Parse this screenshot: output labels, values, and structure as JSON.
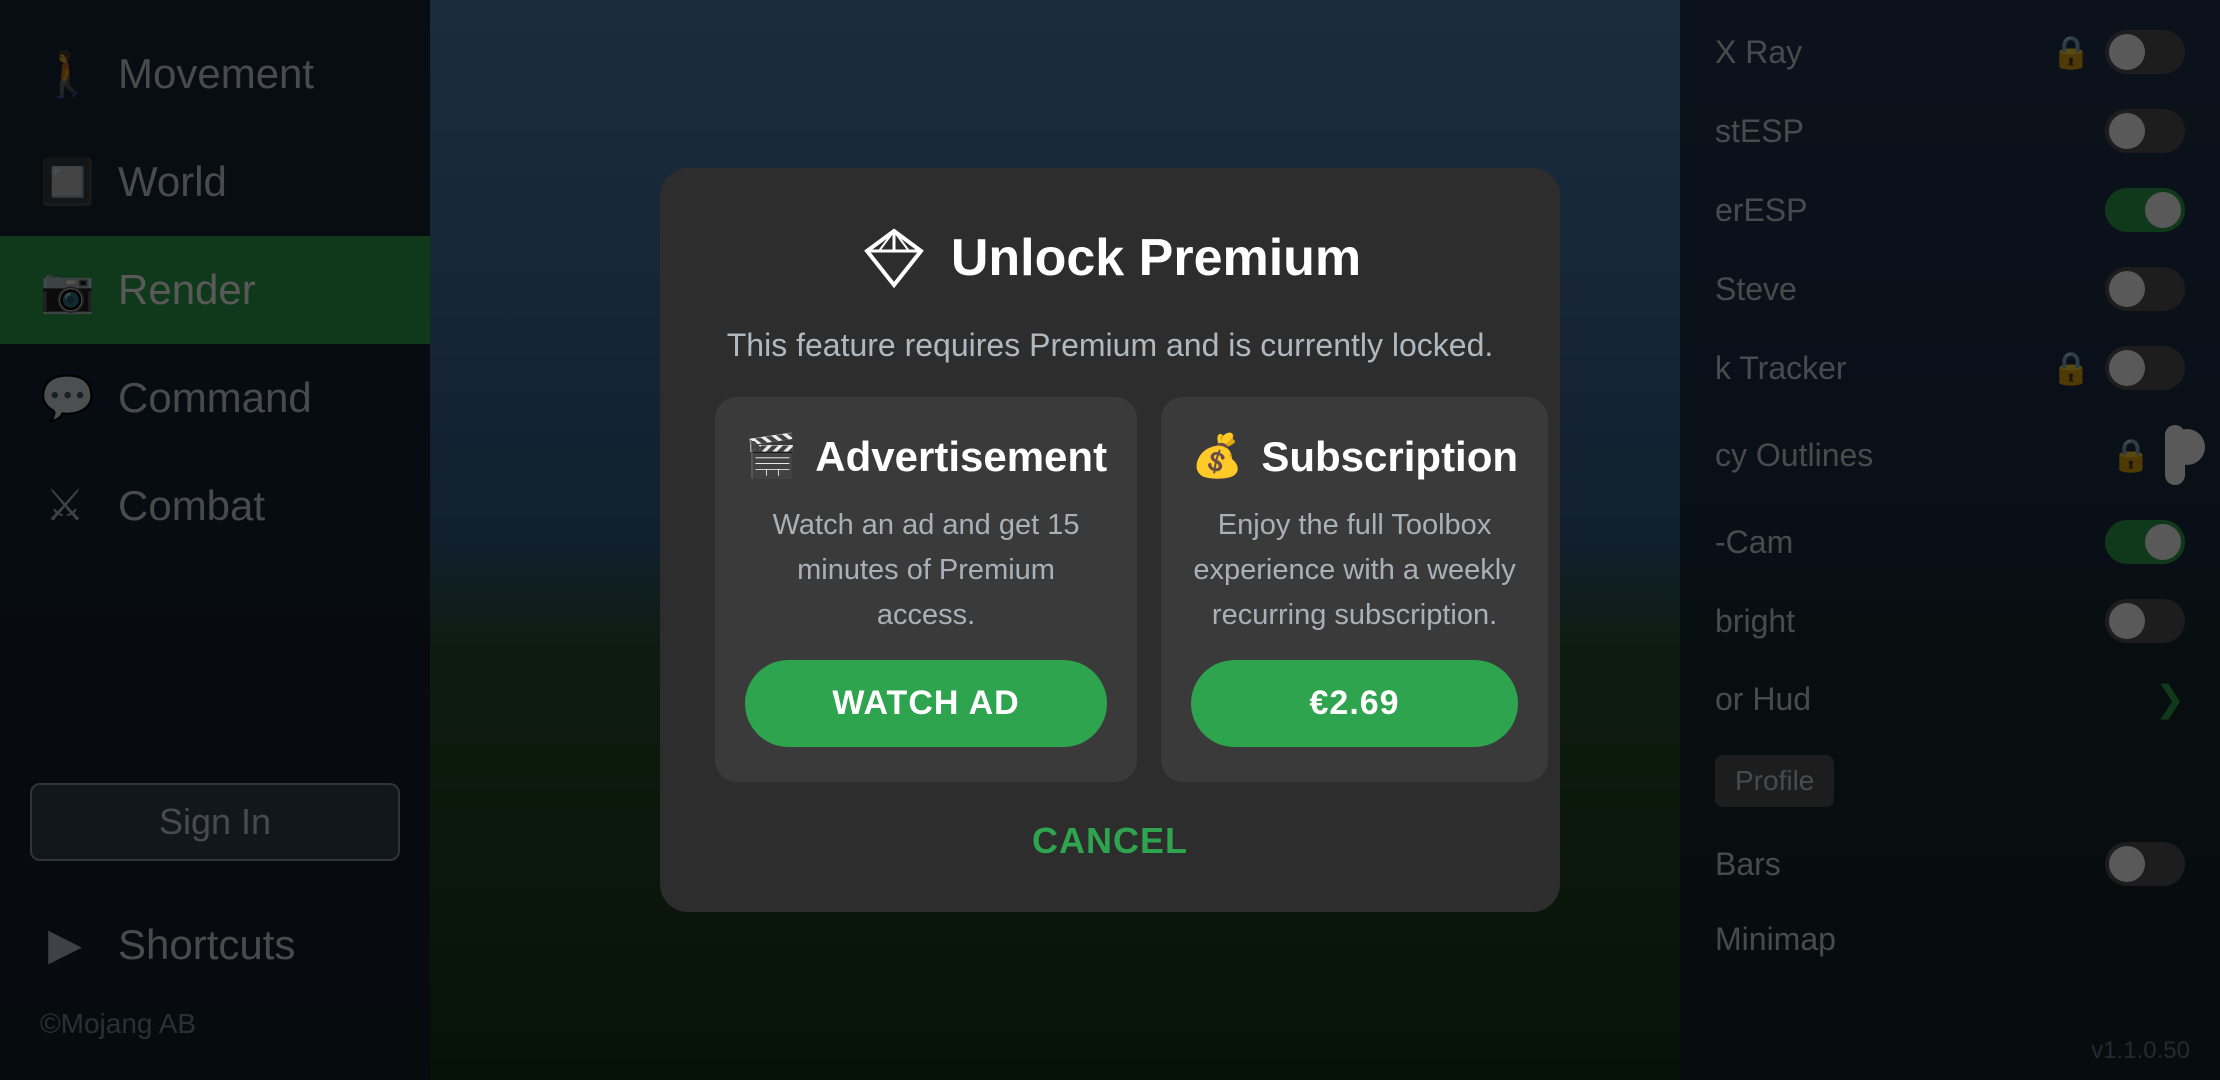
{
  "sidebar": {
    "items": [
      {
        "id": "movement",
        "label": "Movement",
        "icon": "🚶",
        "active": false
      },
      {
        "id": "world",
        "label": "World",
        "icon": "🔲",
        "active": false
      },
      {
        "id": "render",
        "label": "Render",
        "icon": "📷",
        "active": true
      },
      {
        "id": "command",
        "label": "Command",
        "icon": "💬",
        "active": false
      },
      {
        "id": "combat",
        "label": "Combat",
        "icon": "⚔",
        "active": false
      }
    ],
    "shortcuts_label": "Shortcuts",
    "shortcuts_icon": "▶",
    "sign_in_label": "Sign In",
    "mojang_label": "©Mojang AB"
  },
  "right_panel": {
    "items": [
      {
        "label": "X Ray",
        "has_lock": true,
        "toggle": false,
        "id": "xray"
      },
      {
        "label": "stESP",
        "has_lock": false,
        "toggle": false,
        "id": "stesp"
      },
      {
        "label": "erESP",
        "has_lock": false,
        "toggle": true,
        "id": "eresp"
      },
      {
        "label": "Steve",
        "has_lock": false,
        "toggle": false,
        "id": "steve"
      },
      {
        "label": "k Tracker",
        "has_lock": true,
        "toggle": false,
        "id": "ktracker"
      },
      {
        "label": "cy Outlines",
        "has_lock": true,
        "toggle": false,
        "id": "cyoutlines"
      },
      {
        "label": "-Cam",
        "has_lock": false,
        "toggle": true,
        "id": "cam"
      },
      {
        "label": "bright",
        "has_lock": false,
        "toggle": false,
        "id": "bright"
      },
      {
        "label": "or Hud",
        "has_lock": false,
        "toggle": false,
        "chevron": true,
        "id": "orhud"
      },
      {
        "label": "Bars",
        "has_lock": false,
        "toggle": false,
        "id": "bars"
      },
      {
        "label": "Minimap",
        "has_lock": false,
        "toggle": false,
        "id": "minimap"
      }
    ]
  },
  "modal": {
    "title": "Unlock Premium",
    "subtitle": "This feature requires Premium and is currently locked.",
    "ad_card": {
      "title": "Advertisement",
      "icon": "🎬",
      "description": "Watch an ad and get 15 minutes of Premium access.",
      "button_label": "WATCH AD"
    },
    "sub_card": {
      "title": "Subscription",
      "icon": "💰",
      "description": "Enjoy the full Toolbox experience with a weekly recurring subscription.",
      "button_label": "€2.69"
    },
    "cancel_label": "CANCEL"
  },
  "version": "v1.1.0.50",
  "profile_button": "Profile"
}
